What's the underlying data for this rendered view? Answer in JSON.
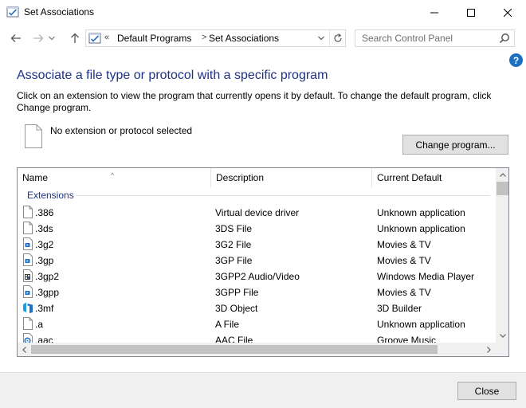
{
  "window": {
    "title": "Set Associations",
    "icon": "control-panel-icon"
  },
  "nav": {
    "back_icon": "arrow-left-icon",
    "forward_icon": "arrow-right-icon",
    "recent_icon": "chevron-down-icon",
    "up_icon": "arrow-up-icon"
  },
  "address": {
    "overflow": "«",
    "crumbs": [
      "Default Programs",
      "Set Associations"
    ],
    "separator": ">"
  },
  "search": {
    "placeholder": "Search Control Panel"
  },
  "help": {
    "label": "?"
  },
  "main": {
    "heading": "Associate a file type or protocol with a specific program",
    "description": "Click on an extension to view the program that currently opens it by default. To change the default program, click Change program.",
    "selected_text": "No extension or protocol selected",
    "change_button": "Change program..."
  },
  "list": {
    "columns": [
      "Name",
      "Description",
      "Current Default"
    ],
    "sort_indicator": "^",
    "group": "Extensions",
    "rows": [
      {
        "name": ".386",
        "description": "Virtual device driver",
        "default": "Unknown application",
        "icon": "blank-file-icon"
      },
      {
        "name": ".3ds",
        "description": "3DS File",
        "default": "Unknown application",
        "icon": "blank-file-icon"
      },
      {
        "name": ".3g2",
        "description": "3G2 File",
        "default": "Movies & TV",
        "icon": "video-file-icon"
      },
      {
        "name": ".3gp",
        "description": "3GP File",
        "default": "Movies & TV",
        "icon": "video-file-icon"
      },
      {
        "name": ".3gp2",
        "description": "3GPP2 Audio/Video",
        "default": "Windows Media Player",
        "icon": "media-player-file-icon"
      },
      {
        "name": ".3gpp",
        "description": "3GPP File",
        "default": "Movies & TV",
        "icon": "video-file-icon"
      },
      {
        "name": ".3mf",
        "description": "3D Object",
        "default": "3D Builder",
        "icon": "3d-builder-icon"
      },
      {
        "name": ".a",
        "description": "A File",
        "default": "Unknown application",
        "icon": "blank-file-icon"
      },
      {
        "name": ".aac",
        "description": "AAC File",
        "default": "Groove Music",
        "icon": "music-file-icon"
      }
    ]
  },
  "footer": {
    "close_button": "Close"
  },
  "colors": {
    "heading": "#1e3287",
    "accent": "#1a6fc1",
    "button_face": "#e1e1e1",
    "footer_bg": "#f0f0f0"
  }
}
